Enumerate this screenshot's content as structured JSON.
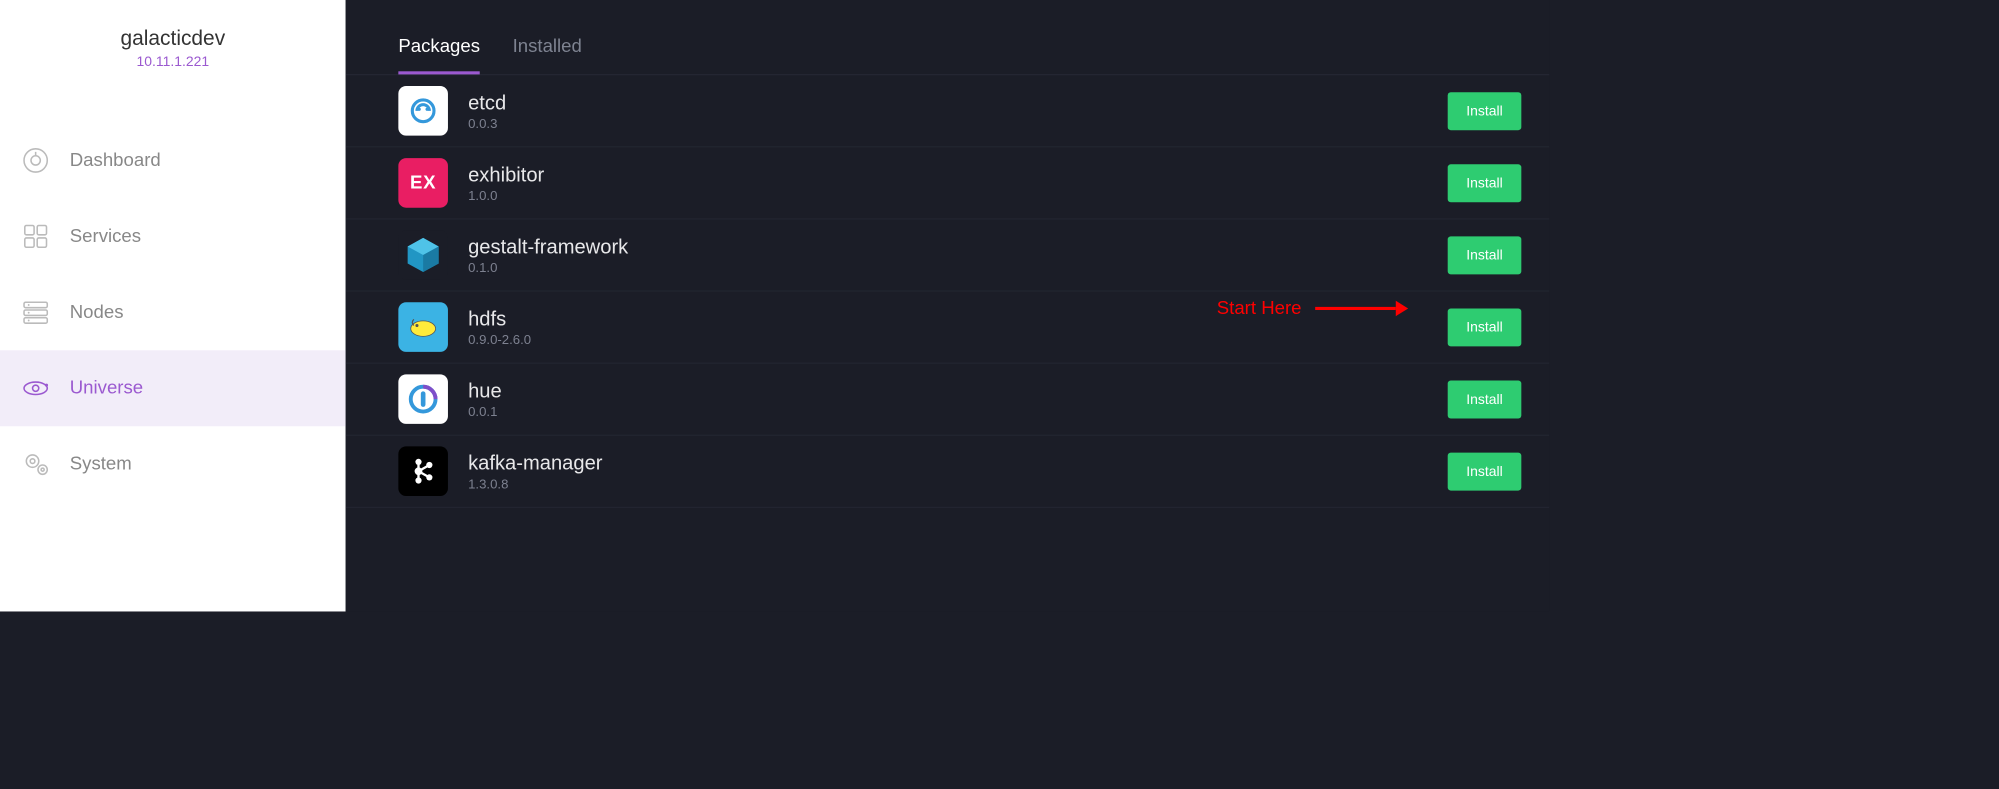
{
  "sidebar": {
    "cluster_name": "galacticdev",
    "cluster_ip": "10.11.1.221",
    "items": [
      {
        "label": "Dashboard",
        "icon": "dashboard-icon",
        "active": false
      },
      {
        "label": "Services",
        "icon": "services-icon",
        "active": false
      },
      {
        "label": "Nodes",
        "icon": "nodes-icon",
        "active": false
      },
      {
        "label": "Universe",
        "icon": "universe-icon",
        "active": true
      },
      {
        "label": "System",
        "icon": "system-icon",
        "active": false
      }
    ]
  },
  "tabs": [
    {
      "label": "Packages",
      "active": true
    },
    {
      "label": "Installed",
      "active": false
    }
  ],
  "packages": [
    {
      "name": "etcd",
      "version": "0.0.3",
      "icon": "etcd",
      "install_label": "Install"
    },
    {
      "name": "exhibitor",
      "version": "1.0.0",
      "icon": "exhibitor",
      "install_label": "Install"
    },
    {
      "name": "gestalt-framework",
      "version": "0.1.0",
      "icon": "gestalt",
      "install_label": "Install"
    },
    {
      "name": "hdfs",
      "version": "0.9.0-2.6.0",
      "icon": "hdfs",
      "install_label": "Install"
    },
    {
      "name": "hue",
      "version": "0.0.1",
      "icon": "hue",
      "install_label": "Install"
    },
    {
      "name": "kafka-manager",
      "version": "1.3.0.8",
      "icon": "kafka",
      "install_label": "Install"
    }
  ],
  "annotation": {
    "text": "Start Here"
  },
  "colors": {
    "accent": "#9b59d0",
    "install_button": "#2ecc71",
    "annotation": "#ff0000"
  }
}
